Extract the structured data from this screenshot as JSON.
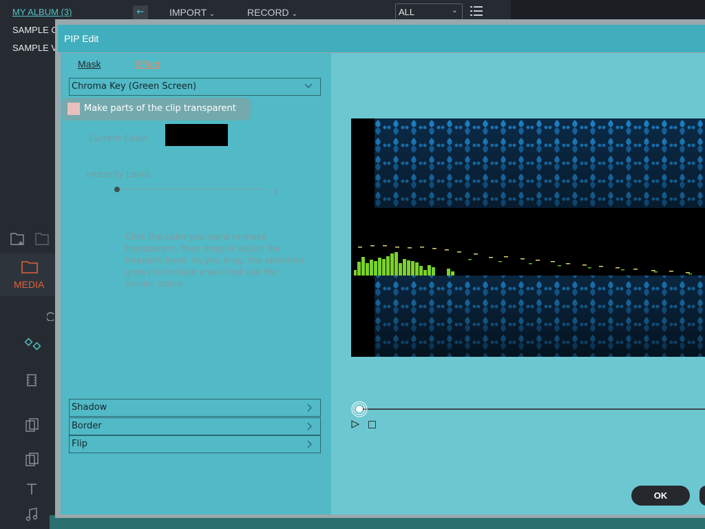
{
  "background_app": {
    "album_title": "MY ALBUM (3)",
    "album_items": [
      "SAMPLE CO",
      "SAMPLE VI"
    ],
    "nav": {
      "back_icon": "arrow-left-icon",
      "import_label": "IMPORT",
      "record_label": "RECORD"
    },
    "filter": {
      "value": "ALL"
    },
    "media_tab_label": "MEDIA"
  },
  "dialog": {
    "title": "PIP Edit",
    "tabs": {
      "mask": "Mask",
      "effect": "Effect"
    },
    "effect_select": {
      "value": "Chroma Key (Green Screen)"
    },
    "transparent_checkbox": {
      "label": "Make parts of the clip transparent",
      "checked": false
    },
    "current_color": {
      "label": "Current Color:",
      "value": "#000000"
    },
    "intensity": {
      "label": "Intensity Level:",
      "value": "1"
    },
    "help_text": "Click the color you want to make transparent, then drag or adjust the intensity level. As you drag, the selection grows to include areas that use the similar colors.",
    "accordions": {
      "shadow": "Shadow",
      "border": "Border",
      "flip": "Flip"
    },
    "ok_label": "OK"
  },
  "colors": {
    "dialog_header": "#40aebc",
    "left_panel": "#51bac6",
    "preview_bg": "#6cc7d0",
    "accent_teal": "#4fc3c8",
    "accent_orange": "#e0603a"
  }
}
